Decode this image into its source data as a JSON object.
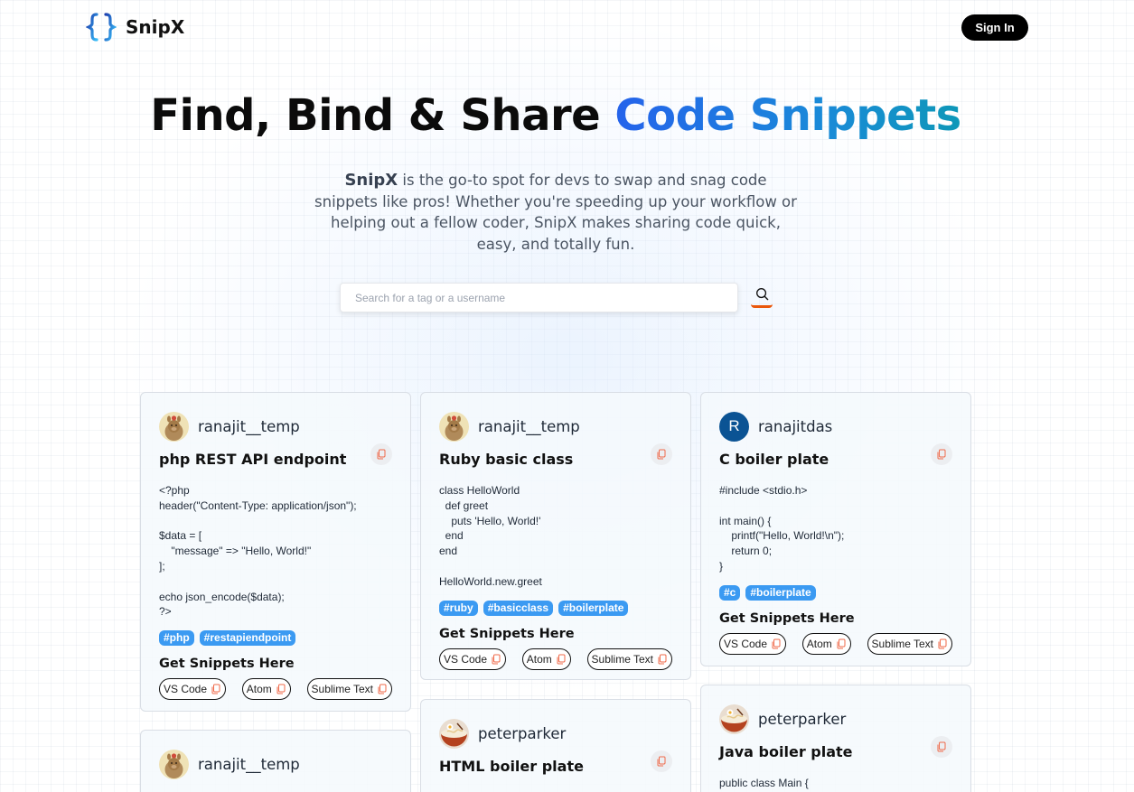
{
  "nav": {
    "brand": "SnipX",
    "signin_label": "Sign In"
  },
  "hero": {
    "title_plain": "Find, Bind & Share ",
    "title_accent": "Code Snippets",
    "desc_brand": "SnipX",
    "desc_rest": " is the go-to spot for devs to swap and snag code snippets like pros! Whether you're speeding up your workflow or helping out a fellow coder, SnipX makes sharing code quick, easy, and totally fun."
  },
  "search": {
    "placeholder": "Search for a tag or a username"
  },
  "colors": {
    "accent_blue": "#2563eb",
    "tag_blue": "#3b9af2",
    "search_underline": "#ea580c",
    "avatar_blue": "#0b5394"
  },
  "get_snippets_label": "Get Snippets Here",
  "editors": [
    "VS Code",
    "Atom",
    "Sublime Text"
  ],
  "cards": [
    {
      "username": "ranajit__temp",
      "avatar": "llama-avatar",
      "title": "php REST API endpoint",
      "code": "<?php\nheader(\"Content-Type: application/json\");\n\n$data = [\n    \"message\" => \"Hello, World!\"\n];\n\necho json_encode($data);\n?>",
      "tags": [
        "#php",
        "#restapiendpoint"
      ]
    },
    {
      "username": "ranajit__temp",
      "avatar": "llama-avatar",
      "title": "Ruby basic class",
      "code": "class HelloWorld\n  def greet\n    puts 'Hello, World!'\n  end\nend\n\nHelloWorld.new.greet",
      "tags": [
        "#ruby",
        "#basicclass",
        "#boilerplate"
      ]
    },
    {
      "username": "ranajitdas",
      "avatar": "letter-avatar",
      "avatar_letter": "R",
      "title": "C boiler plate",
      "code": "#include <stdio.h>\n\nint main() {\n    printf(\"Hello, World!\\n\");\n    return 0;\n}",
      "tags": [
        "#c",
        "#boilerplate"
      ]
    },
    {
      "username": "peterparker",
      "avatar": "ramen-avatar",
      "title": "HTML boiler plate"
    },
    {
      "username": "peterparker",
      "avatar": "ramen-avatar",
      "title": "Java boiler plate",
      "code": "public class Main {"
    },
    {
      "username": "ranajit__temp",
      "avatar": "llama-avatar"
    }
  ]
}
